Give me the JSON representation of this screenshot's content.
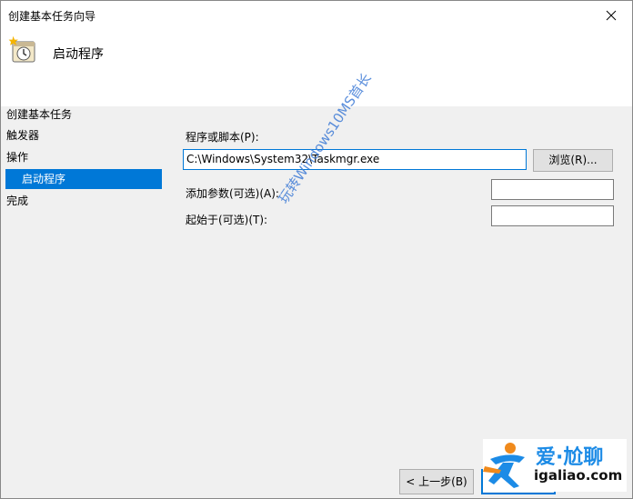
{
  "window": {
    "title": "创建基本任务向导"
  },
  "header": {
    "title": "启动程序"
  },
  "steps": [
    {
      "label": "创建基本任务"
    },
    {
      "label": "触发器"
    },
    {
      "label": "操作"
    },
    {
      "label": "启动程序"
    },
    {
      "label": "完成"
    }
  ],
  "form": {
    "program_label": "程序或脚本(P):",
    "program_value": "C:\\Windows\\System32\\Taskmgr.exe",
    "browse_label": "浏览(R)...",
    "args_label": "添加参数(可选)(A):",
    "args_value": "",
    "startin_label": "起始于(可选)(T):",
    "startin_value": ""
  },
  "footer": {
    "back_label": "< 上一步(B)"
  },
  "overlay": {
    "watermark": "玩转Windows10MS首长",
    "logo_name": "爱·尬聊",
    "logo_url": "igaliao.com"
  },
  "colors": {
    "accent": "#0078d7",
    "watermark": "#3e7bd6",
    "logo_blue": "#1c8be6",
    "logo_orange": "#f08a1c"
  },
  "icons": [
    "close-icon",
    "task-clock-icon",
    "runner-logo-icon"
  ]
}
